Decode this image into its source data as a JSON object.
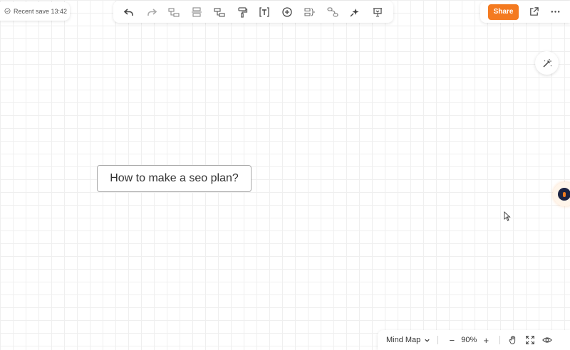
{
  "save_status": {
    "text": "Recent save 13:42",
    "icon": "check-circle-icon"
  },
  "toolbar": {
    "buttons": [
      {
        "name": "undo",
        "icon": "undo-icon"
      },
      {
        "name": "redo",
        "icon": "redo-icon"
      },
      {
        "name": "add-subtopic",
        "icon": "subtopic-icon"
      },
      {
        "name": "add-sibling-topic",
        "icon": "sibling-topic-icon"
      },
      {
        "name": "add-parent-topic",
        "icon": "parent-topic-icon"
      },
      {
        "name": "format-painter",
        "icon": "paint-roller-icon"
      },
      {
        "name": "text-style",
        "icon": "text-box-icon"
      },
      {
        "name": "insert",
        "icon": "plus-circle-icon"
      },
      {
        "name": "summary",
        "icon": "summary-icon"
      },
      {
        "name": "relationship",
        "icon": "relationship-icon"
      },
      {
        "name": "style",
        "icon": "sparkle-icon"
      },
      {
        "name": "presentation",
        "icon": "presentation-icon"
      }
    ]
  },
  "header_right": {
    "share_label": "Share",
    "icons": [
      "export-icon",
      "more-icon"
    ]
  },
  "canvas": {
    "central_topic": "How to make a seo plan?"
  },
  "bottom_bar": {
    "layout_label": "Mind Map",
    "zoom_minus": "−",
    "zoom_value": "90%",
    "zoom_plus": "+"
  },
  "colors": {
    "accent": "#f47a20",
    "assistant": "#1d2443",
    "grid": "#efefef"
  }
}
